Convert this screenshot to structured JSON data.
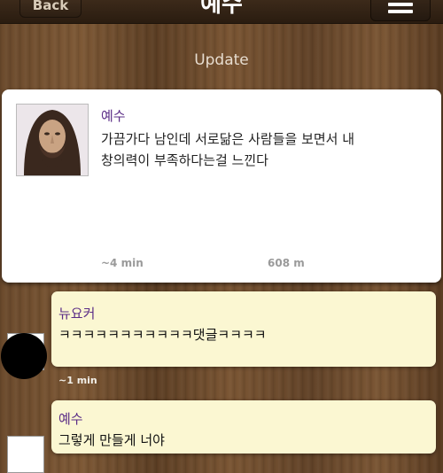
{
  "header": {
    "back_label": "Back",
    "title": "예수",
    "menu_icon": "hamburger-menu-icon"
  },
  "section": {
    "label": "Update"
  },
  "post": {
    "author": "예수",
    "line1": "가끔가다 남인데 서로닮은 사람들을 보면서 내",
    "line2": "창의력이 부족하다는걸 느낀다",
    "time": "~4 min",
    "distance": "608 m"
  },
  "comments": [
    {
      "author": "뉴요커",
      "text": "ㅋㅋㅋㅋㅋㅋㅋㅋㅋㅋㅋ댓글ㅋㅋㅋㅋ",
      "time": "~1 min"
    },
    {
      "author": "예수",
      "text": "그렇게 만들게 너야"
    }
  ],
  "colors": {
    "author_name": "#5a2c86",
    "comment_bg": "#fbf7d2",
    "card_bg": "#ffffff",
    "wood_bg": "#6b4a2c"
  }
}
